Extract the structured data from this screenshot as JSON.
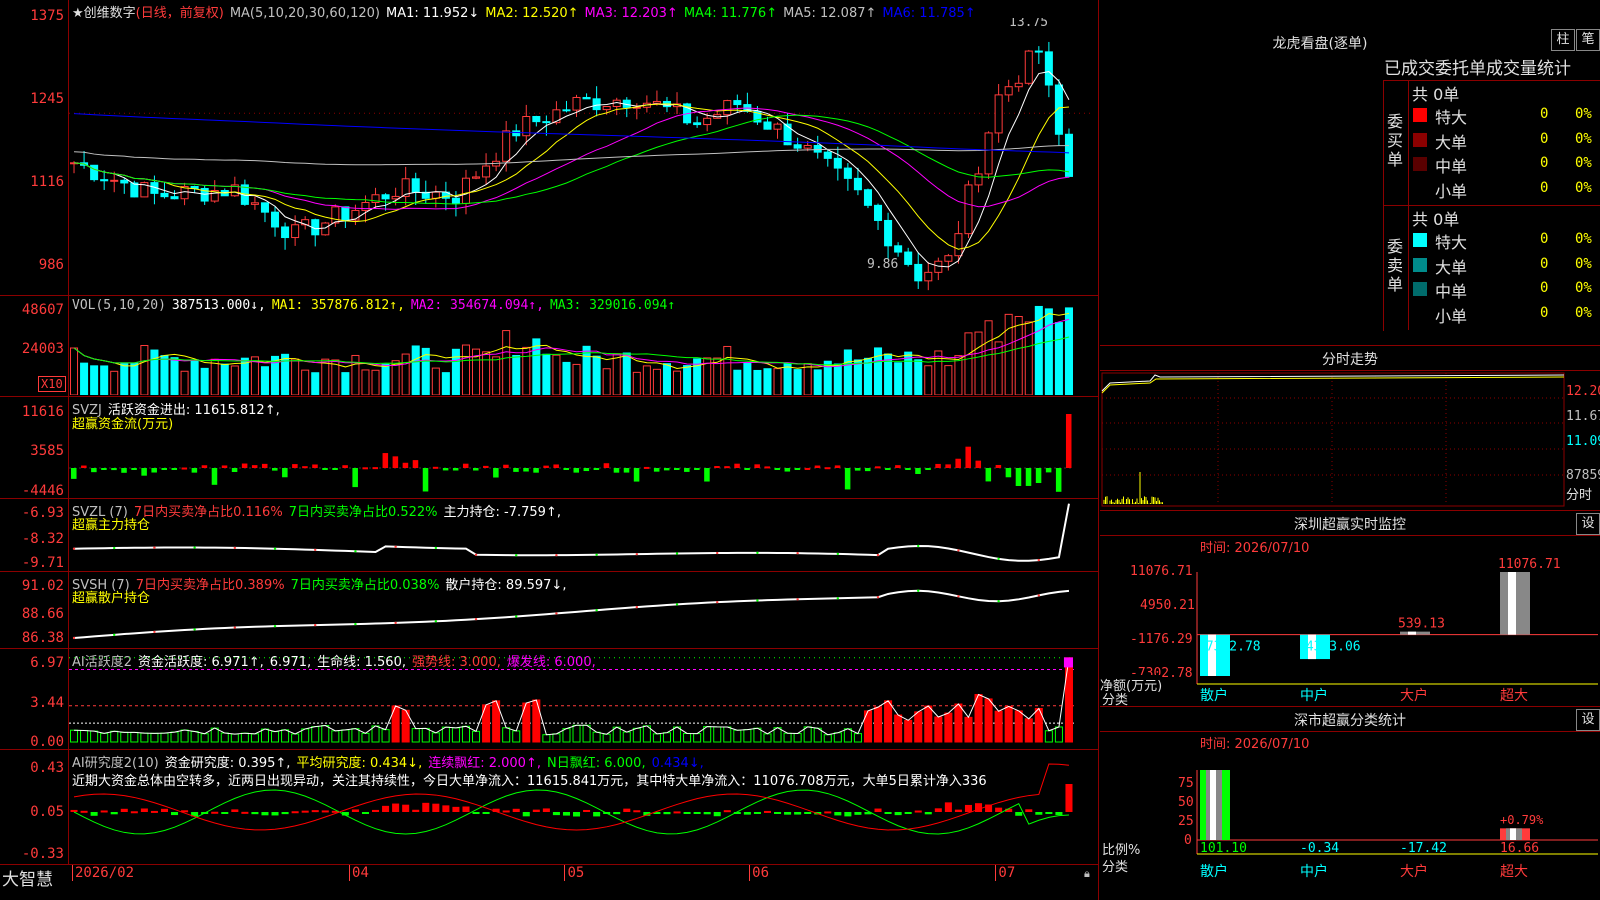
{
  "main": {
    "title": "★创维数字",
    "mode": "(日线，前复权)",
    "ma_params": "MA(5,10,20,30,60,120)",
    "ma_labels": [
      {
        "text": "MA1: 11.952↓",
        "color": "#ffffff"
      },
      {
        "text": "MA2: 12.520↑",
        "color": "#ffff00"
      },
      {
        "text": "MA3: 12.203↑",
        "color": "#ff00ff"
      },
      {
        "text": "MA4: 11.776↑",
        "color": "#00ff00"
      },
      {
        "text": "MA5: 12.087↑",
        "color": "#c0c0c0"
      },
      {
        "text": "MA6: 11.785↑",
        "color": "#0000ff"
      }
    ],
    "y_ticks": [
      "1375",
      "1245",
      "1116",
      "986"
    ],
    "high_label": "13.75",
    "low_label": "9.86"
  },
  "vol": {
    "header": [
      {
        "text": "VOL(5,10,20)",
        "color": "#c0c0c0"
      },
      {
        "text": "387513.000↓,",
        "color": "#ffffff"
      },
      {
        "text": "MA1: 357876.812↑,",
        "color": "#ffff00"
      },
      {
        "text": "MA2: 354674.094↑,",
        "color": "#ff00ff"
      },
      {
        "text": "MA3: 329016.094↑",
        "color": "#00ff00"
      }
    ],
    "y_ticks": [
      "48607",
      "24003"
    ],
    "unit": "X10"
  },
  "svzj": {
    "header": [
      {
        "text": "SVZJ",
        "color": "#c0c0c0"
      },
      {
        "text": "活跃资金进出: 11615.812↑,",
        "color": "#ffffff"
      }
    ],
    "sub": "超赢资金流(万元)",
    "y_ticks": [
      "11616",
      "3585",
      "-4446"
    ]
  },
  "svzl": {
    "header": [
      {
        "text": "SVZL (7)",
        "color": "#c0c0c0"
      },
      {
        "text": "7日内买卖净占比0.116%",
        "color": "#ff3b3b"
      },
      {
        "text": "7日内买卖净占比0.522%",
        "color": "#00ff00"
      },
      {
        "text": "主力持仓: -7.759↑,",
        "color": "#ffffff"
      }
    ],
    "sub": "超赢主力持仓",
    "y_ticks": [
      "-6.93",
      "-8.32",
      "-9.71"
    ]
  },
  "svsh": {
    "header": [
      {
        "text": "SVSH (7)",
        "color": "#c0c0c0"
      },
      {
        "text": "7日内买卖净占比0.389%",
        "color": "#ff3b3b"
      },
      {
        "text": "7日内买卖净占比0.038%",
        "color": "#00ff00"
      },
      {
        "text": "散户持仓: 89.597↓,",
        "color": "#ffffff"
      }
    ],
    "sub": "超赢散户持仓",
    "y_ticks": [
      "91.02",
      "88.66",
      "86.38"
    ]
  },
  "ai1": {
    "header": [
      {
        "text": "AI活跃度2",
        "color": "#c0c0c0"
      },
      {
        "text": "资金活跃度: 6.971↑,",
        "color": "#ffffff"
      },
      {
        "text": "6.971,",
        "color": "#ffffff"
      },
      {
        "text": "生命线: 1.560,",
        "color": "#ffffff"
      },
      {
        "text": "强势线: 3.000,",
        "color": "#ff3b3b"
      },
      {
        "text": "爆发线: 6.000,",
        "color": "#ff00ff"
      }
    ],
    "y_ticks": [
      "6.97",
      "3.44",
      "0.00"
    ]
  },
  "ai2": {
    "header": [
      {
        "text": "AI研究度2(10)",
        "color": "#c0c0c0"
      },
      {
        "text": "资金研究度: 0.395↑,",
        "color": "#ffffff"
      },
      {
        "text": "平均研究度: 0.434↓,",
        "color": "#ffff00"
      },
      {
        "text": "连续飘红: 2.000↑,",
        "color": "#ff00ff"
      },
      {
        "text": "N日飘红: 6.000,",
        "color": "#00ff00"
      },
      {
        "text": "0.434↓,",
        "color": "#0000ff"
      }
    ],
    "comment": "近期大资金总体由空转多，近两日出现异动，关注其持续性，今日大单净流入：11615.841万元，其中特大单净流入：11076.708万元，大单5日累计净入336",
    "y_ticks": [
      "0.43",
      "0.05",
      "-0.33"
    ]
  },
  "xaxis": {
    "brand": "大智慧",
    "labels": [
      {
        "text": "2026/02",
        "pos": 0.0
      },
      {
        "text": "04",
        "pos": 0.27
      },
      {
        "text": "05",
        "pos": 0.48
      },
      {
        "text": "06",
        "pos": 0.66
      },
      {
        "text": "07",
        "pos": 0.9
      }
    ]
  },
  "dragon": {
    "title": "龙虎看盘(逐单)",
    "btn_bar": "柱",
    "btn_pen": "笔",
    "tabs": [
      "已成交",
      "委托单",
      "成交量统计"
    ],
    "buy_label": "委买单",
    "sell_label": "委卖单",
    "buy_total": "共 0单",
    "sell_total": "共 0单",
    "rows": [
      {
        "label": "特大",
        "count": "0",
        "pct": "0%"
      },
      {
        "label": "大单",
        "count": "0",
        "pct": "0%"
      },
      {
        "label": "中单",
        "count": "0",
        "pct": "0%"
      },
      {
        "label": "小单",
        "count": "0",
        "pct": "0%"
      }
    ],
    "buy_colors": [
      "#ff0000",
      "#8b0000",
      "#5a0000",
      "#000000"
    ],
    "sell_colors": [
      "#00ffff",
      "#008b8b",
      "#006b6b",
      "#000000"
    ]
  },
  "intraday": {
    "title": "分时走势",
    "y_ticks": [
      "12.20",
      "11.67",
      "11.09",
      "87859"
    ],
    "y_tick_colors": [
      "#ff3b3b",
      "#c0c0c0",
      "#00ffff",
      "#c0c0c0"
    ],
    "foot": "分时"
  },
  "monitor": {
    "title": "深圳超赢实时监控",
    "btn": "设",
    "time": "时间: 2026/07/10",
    "y_ticks": [
      "11076.71",
      "4950.21",
      "-1176.29",
      "-7302.78"
    ],
    "unit": "净额(万元)",
    "cat_label": "分类",
    "categories": [
      "散户",
      "中户",
      "大户",
      "超大"
    ],
    "values": [
      -7302.78,
      -4313.06,
      539.13,
      11076.71
    ],
    "value_labels": [
      "-7302.78",
      "-4313.06",
      "539.13",
      "11076.71"
    ],
    "ylim": [
      -7302.78,
      11076.71
    ]
  },
  "stats": {
    "title": "深市超赢分类统计",
    "btn": "设",
    "time": "时间: 2026/07/10",
    "y_ticks": [
      "75",
      "50",
      "25",
      "0"
    ],
    "unit": "比例%",
    "cat_label": "分类",
    "categories": [
      "散户",
      "中户",
      "大户",
      "超大"
    ],
    "values": [
      101.1,
      -0.34,
      -17.42,
      16.66
    ],
    "value_labels": [
      "101.10",
      "-0.34",
      "-17.42",
      "16.66"
    ],
    "extra_label": "+0.79%"
  }
}
